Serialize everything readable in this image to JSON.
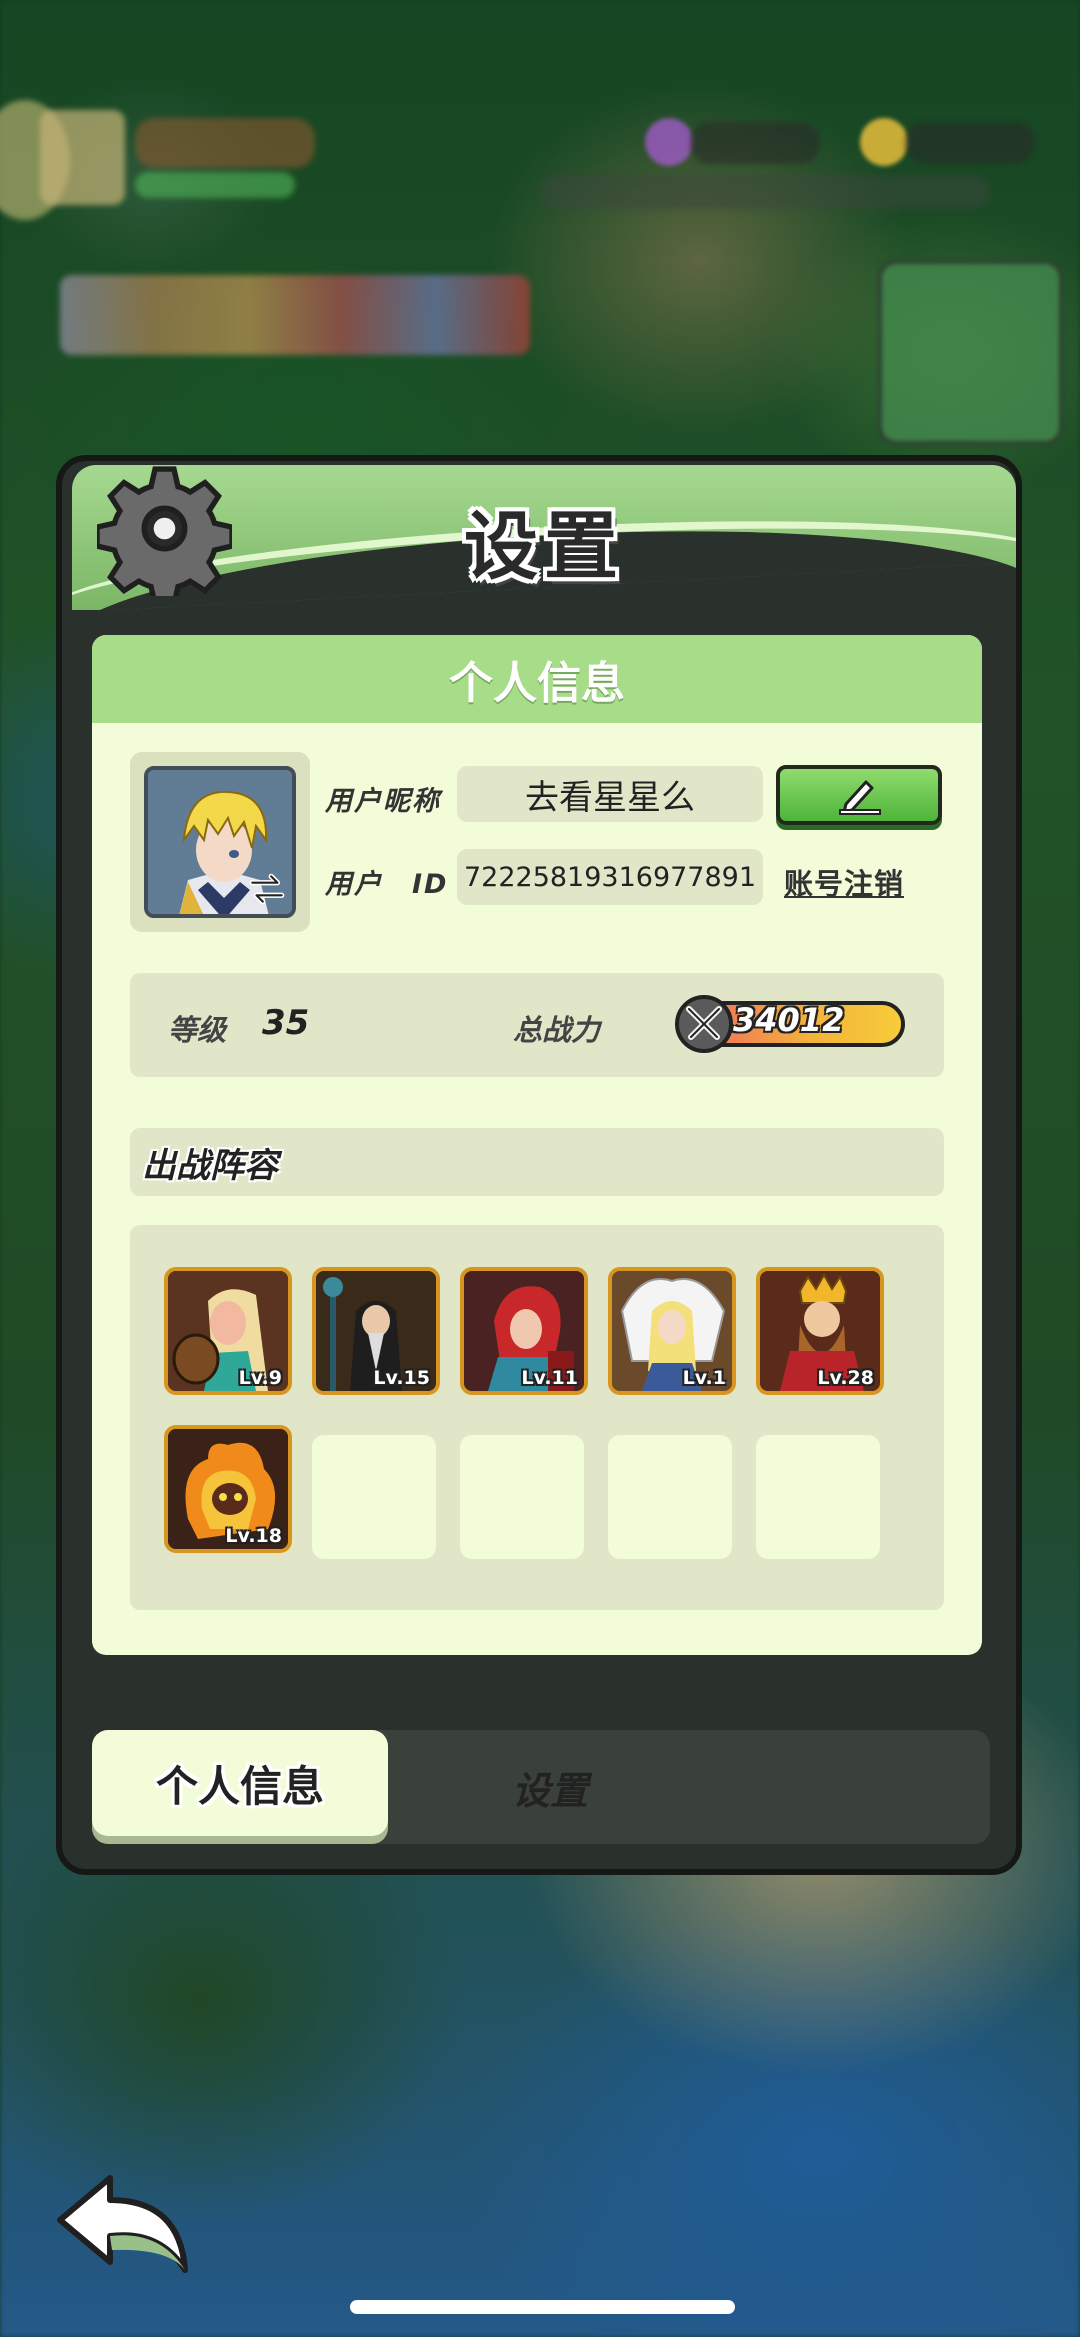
{
  "panel": {
    "title": "设置"
  },
  "profile": {
    "section_title": "个人信息",
    "nickname_label": "用户昵称",
    "nickname": "去看星星么",
    "id_label": "用户　ID",
    "user_id": "72225819316977891",
    "cancel_account": "账号注销"
  },
  "stats": {
    "level_label": "等级",
    "level": "35",
    "power_label": "总战力",
    "power": "34012"
  },
  "lineup": {
    "title": "出战阵容",
    "heroes": [
      {
        "level": "Lv.9"
      },
      {
        "level": "Lv.15"
      },
      {
        "level": "Lv.11"
      },
      {
        "level": "Lv.1"
      },
      {
        "level": "Lv.28"
      },
      {
        "level": "Lv.18"
      }
    ]
  },
  "tabs": {
    "profile": "个人信息",
    "settings": "设置"
  },
  "colors": {
    "header_green": "#a6d990",
    "card_bg": "#f3fcd9",
    "field_bg": "#e2e6c8",
    "hero_border": "#d7961f",
    "edit_green": "#4fb43a"
  }
}
